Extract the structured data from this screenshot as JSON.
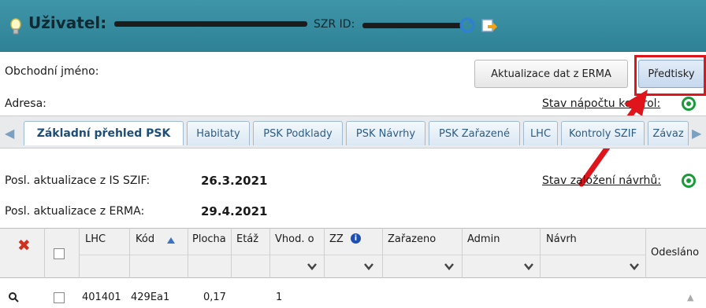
{
  "header": {
    "user_label": "Uživatel:",
    "szr_label": "SZR ID:"
  },
  "info": {
    "business_name_label": "Obchodní jméno:",
    "address_label": "Adresa:",
    "update_button": "Aktualizace dat z ERMA",
    "templates_button": "Předtisky",
    "stav_napoctu_link": "Stav nápočtu kontrol:",
    "stav_zalozeni_link": "Stav založení návrhů:",
    "last_szif_label": "Posl. aktualizace z IS SZIF:",
    "last_szif_value": "26.3.2021",
    "last_erma_label": "Posl. aktualizace z ERMA:",
    "last_erma_value": "29.4.2021"
  },
  "tabs": [
    "Základní přehled PSK",
    "Habitaty",
    "PSK Podklady",
    "PSK Návrhy",
    "PSK Zařazené",
    "LHC",
    "Kontroly SZIF",
    "Závaz"
  ],
  "grid": {
    "columns": [
      "LHC",
      "Kód",
      "Plocha",
      "Etáž",
      "Vhod. o",
      "ZZ",
      "Zařazeno",
      "Admin",
      "Návrh",
      "Odesláno"
    ],
    "rows": [
      {
        "lhc": "401401",
        "kod": "429Ea1",
        "plocha": "0,17",
        "etaz": "1"
      }
    ]
  },
  "colors": {
    "header": "#3a8fa3",
    "tab_text": "#2b5c85",
    "highlight": "#e0141b",
    "ok": "#1a9b3a"
  },
  "icons": [
    "bulb-icon",
    "refresh-icon",
    "export-icon",
    "ok-circle-icon",
    "delete-x-icon",
    "info-icon",
    "search-icon",
    "sort-asc-icon",
    "dropdown-icon"
  ]
}
